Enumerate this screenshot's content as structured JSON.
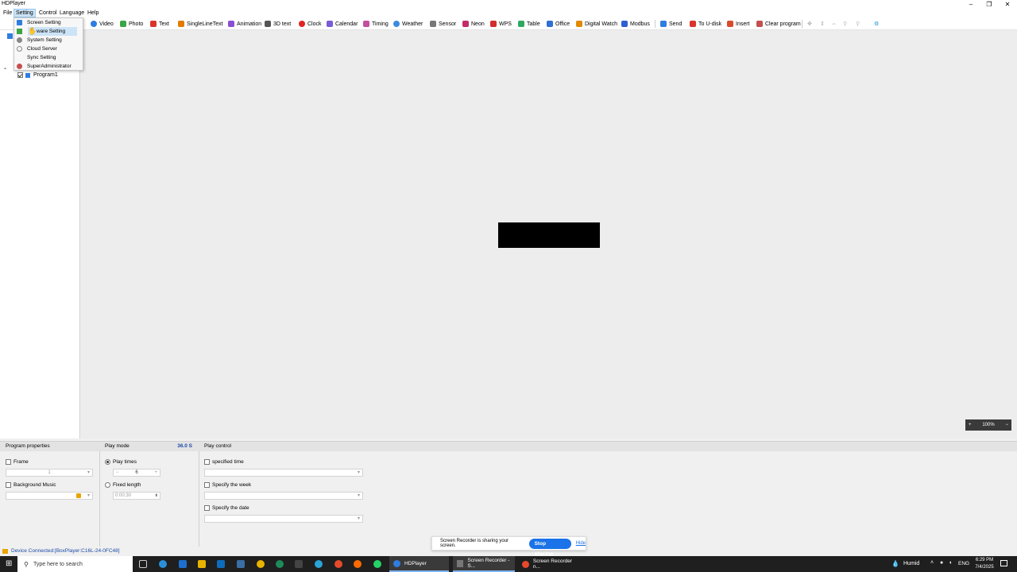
{
  "window": {
    "title": "HDPlayer",
    "controls": [
      "–",
      "❐",
      "✕"
    ]
  },
  "menubar": {
    "items": [
      "File",
      "Setting",
      "Control",
      "Language",
      "Help"
    ],
    "active": "Setting"
  },
  "setting_menu": {
    "items": [
      "Screen Setting",
      "Hardware Setting",
      "System Setting",
      "Cloud Server",
      "Sync Setting",
      "SuperAdministrator"
    ],
    "highlighted_visible_text": "ware Setting"
  },
  "toolbar": {
    "items": [
      {
        "label": "Video",
        "icon": "video-icon",
        "color": "#2f7de1"
      },
      {
        "label": "Photo",
        "icon": "photo-icon",
        "color": "#3ba545"
      },
      {
        "label": "Text",
        "icon": "text-icon",
        "color": "#d9342b"
      },
      {
        "label": "SingleLineText",
        "icon": "single-line-text-icon",
        "color": "#e07b00"
      },
      {
        "label": "Animation",
        "icon": "animation-icon",
        "color": "#8a4fd1"
      },
      {
        "label": "3D text",
        "icon": "3d-text-icon",
        "color": "#555555"
      },
      {
        "label": "Clock",
        "icon": "clock-icon",
        "color": "#e02424"
      },
      {
        "label": "Calendar",
        "icon": "calendar-icon",
        "color": "#7a5bd6"
      },
      {
        "label": "Timing",
        "icon": "timing-icon",
        "color": "#c44fa0"
      },
      {
        "label": "Weather",
        "icon": "weather-icon",
        "color": "#3b8be0"
      },
      {
        "label": "Sensor",
        "icon": "sensor-icon",
        "color": "#777777"
      },
      {
        "label": "Neon",
        "icon": "neon-icon",
        "color": "#c42b6b"
      },
      {
        "label": "WPS",
        "icon": "wps-icon",
        "color": "#d42b2b"
      },
      {
        "label": "Table",
        "icon": "table-icon",
        "color": "#2fa860"
      },
      {
        "label": "Office",
        "icon": "office-icon",
        "color": "#2f6fd1"
      },
      {
        "label": "Digital Watch",
        "icon": "digital-watch-icon",
        "color": "#e08a00"
      },
      {
        "label": "Modbus",
        "icon": "modbus-icon",
        "color": "#2f5fd1"
      },
      {
        "label": "Send",
        "icon": "send-icon",
        "color": "#2f7de1"
      },
      {
        "label": "To U-disk",
        "icon": "u-disk-icon",
        "color": "#d9342b"
      },
      {
        "label": "Insert",
        "icon": "insert-icon",
        "color": "#d94a2b"
      },
      {
        "label": "Clear program",
        "icon": "clear-program-icon",
        "color": "#c44f4f"
      }
    ]
  },
  "tree": {
    "program": "Program1"
  },
  "canvas": {
    "zoom": "100%"
  },
  "bottom": {
    "program_properties": {
      "header": "Program properties",
      "frame_label": "Frame",
      "frame_value": "1",
      "music_label": "Background Music"
    },
    "play_mode": {
      "header": "Play mode",
      "duration": "36.0 S",
      "play_times_label": "Play times",
      "play_times_value": "6",
      "fixed_length_label": "Fixed length",
      "fixed_length_value": "0:00:30"
    },
    "play_control": {
      "header": "Play control",
      "specified_time": "specified time",
      "specify_week": "Specify the week",
      "specify_date": "Specify the date"
    }
  },
  "status": {
    "device": "Device Connected:[BoxPlayer:C16L-24-0FC48]"
  },
  "screen_share": {
    "message": "Screen Recorder is sharing your screen.",
    "stop": "Stop sharing",
    "hide": "Hide"
  },
  "taskbar": {
    "search_placeholder": "Type here to search",
    "apps": [
      {
        "label": "HDPlayer"
      },
      {
        "label": "Screen Recorder - S..."
      },
      {
        "label": "Screen Recorder n..."
      }
    ],
    "weather": "Humid",
    "lang": "ENG",
    "time": "6:29 PM",
    "date": "7/4/2025"
  }
}
